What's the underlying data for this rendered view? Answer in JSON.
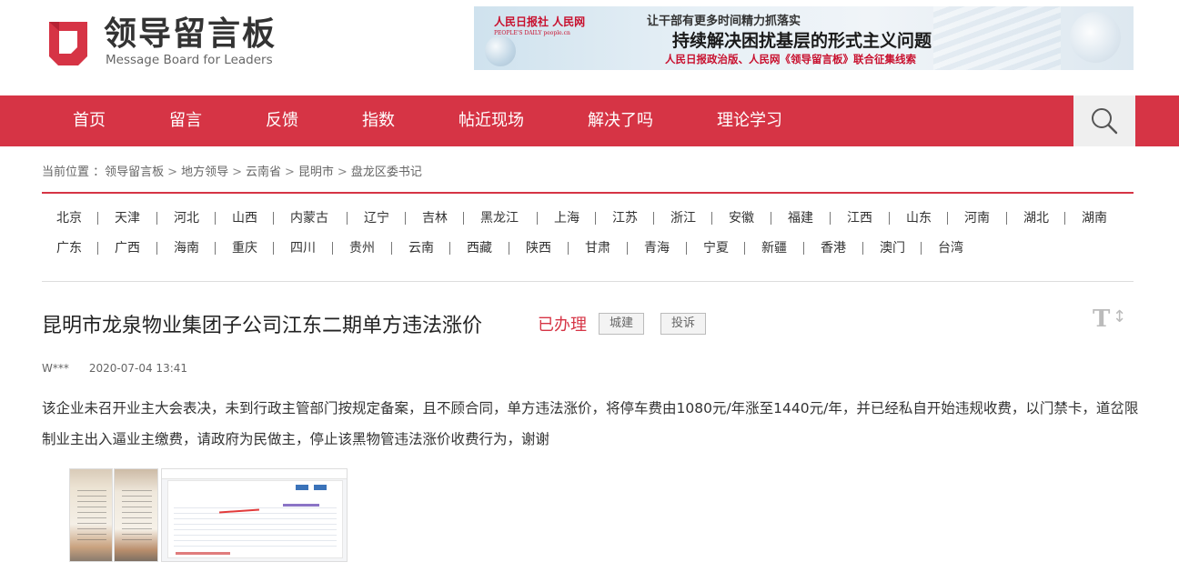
{
  "header": {
    "logo_cn": "领导留言板",
    "logo_en": "Message Board for Leaders",
    "banner": {
      "publisher_logos": "人民日报社  人民网",
      "publisher_sub": "PEOPLE'S DAILY   people.cn",
      "line1": "让干部有更多时间精力抓落实",
      "line2": "持续解决困扰基层的形式主义问题",
      "line3": "人民日报政治版、人民网《领导留言板》联合征集线索"
    }
  },
  "nav": {
    "items": [
      "首页",
      "留言",
      "反馈",
      "指数",
      "帖近现场",
      "解决了吗",
      "理论学习"
    ],
    "search_icon": "search-icon"
  },
  "breadcrumb": {
    "label": "当前位置 ：",
    "items": [
      "领导留言板",
      "地方领导",
      "云南省",
      "昆明市",
      "盘龙区委书记"
    ],
    "separator": ">"
  },
  "regions": {
    "row1": [
      "北京",
      "天津",
      "河北",
      "山西",
      "内蒙古",
      "辽宁",
      "吉林",
      "黑龙江",
      "上海",
      "江苏",
      "浙江",
      "安徽",
      "福建",
      "江西",
      "山东",
      "河南",
      "湖北",
      "湖南"
    ],
    "row2": [
      "广东",
      "广西",
      "海南",
      "重庆",
      "四川",
      "贵州",
      "云南",
      "西藏",
      "陕西",
      "甘肃",
      "青海",
      "宁夏",
      "新疆",
      "香港",
      "澳门",
      "台湾"
    ]
  },
  "article": {
    "title": "昆明市龙泉物业集团子公司江东二期单方违法涨价",
    "status": "已办理",
    "tags": [
      "城建",
      "投诉"
    ],
    "font_toggle": "T",
    "font_toggle_arrow": "↕",
    "author": "W***",
    "time": "2020-07-04 13:41",
    "body": "该企业未召开业主大会表决，未到行政主管部门按规定备案，且不顾合同，单方违法涨价，将停车费由1080元/年涨至1440元/年，并已经私自开始违规收费，以门禁卡，道岔限制业主出入逼业主缴费，请政府为民做主，停止该黑物管违法涨价收费行为，谢谢"
  },
  "colors": {
    "brand_red": "#d63445",
    "search_bg": "#efefef"
  }
}
